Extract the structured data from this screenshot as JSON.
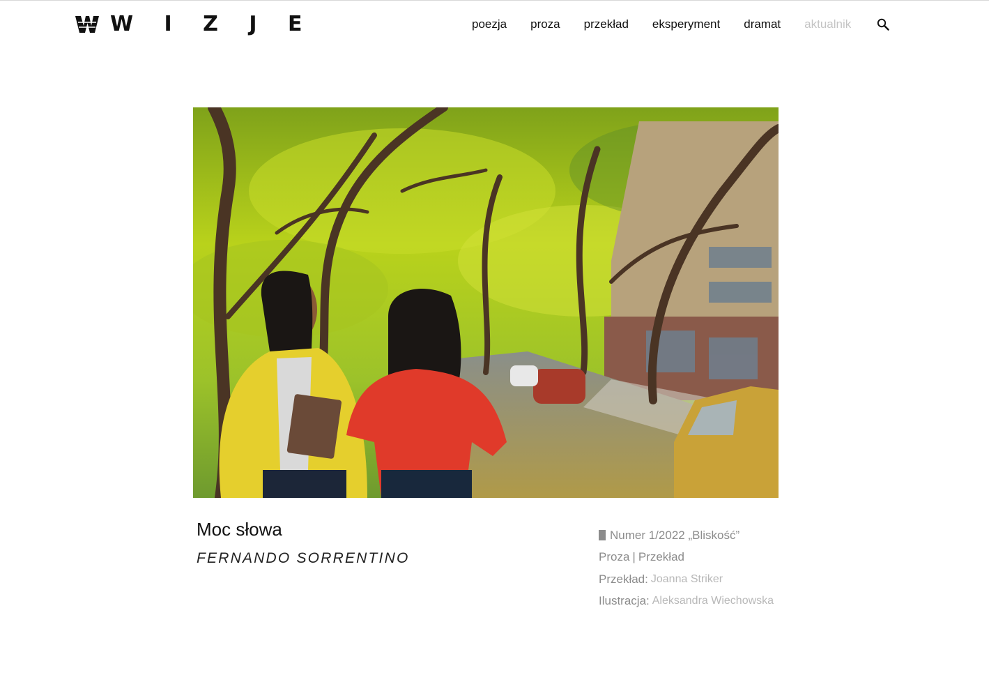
{
  "header": {
    "logo_text": "W I Z J E",
    "nav": [
      {
        "label": "poezja"
      },
      {
        "label": "proza"
      },
      {
        "label": "przekład"
      },
      {
        "label": "eksperyment"
      },
      {
        "label": "dramat"
      },
      {
        "label": "aktualnik"
      }
    ],
    "search_icon": "search-icon"
  },
  "article": {
    "title": "Moc słowa",
    "author": "FERNANDO SORRENTINO",
    "issue": "Numer 1/2022 „Bliskość”",
    "category": "Proza",
    "separator": "|",
    "subcategory": "Przekład",
    "translation_label": "Przekład:",
    "translator": "Joanna Striker",
    "illustration_label": "Ilustracja:",
    "illustrator": "Aleksandra Wiechowska"
  },
  "colors": {
    "text": "#111111",
    "muted_nav": "#c4c4c4",
    "meta_grey": "#8c8c8c",
    "meta_value": "#b8b8b8"
  }
}
